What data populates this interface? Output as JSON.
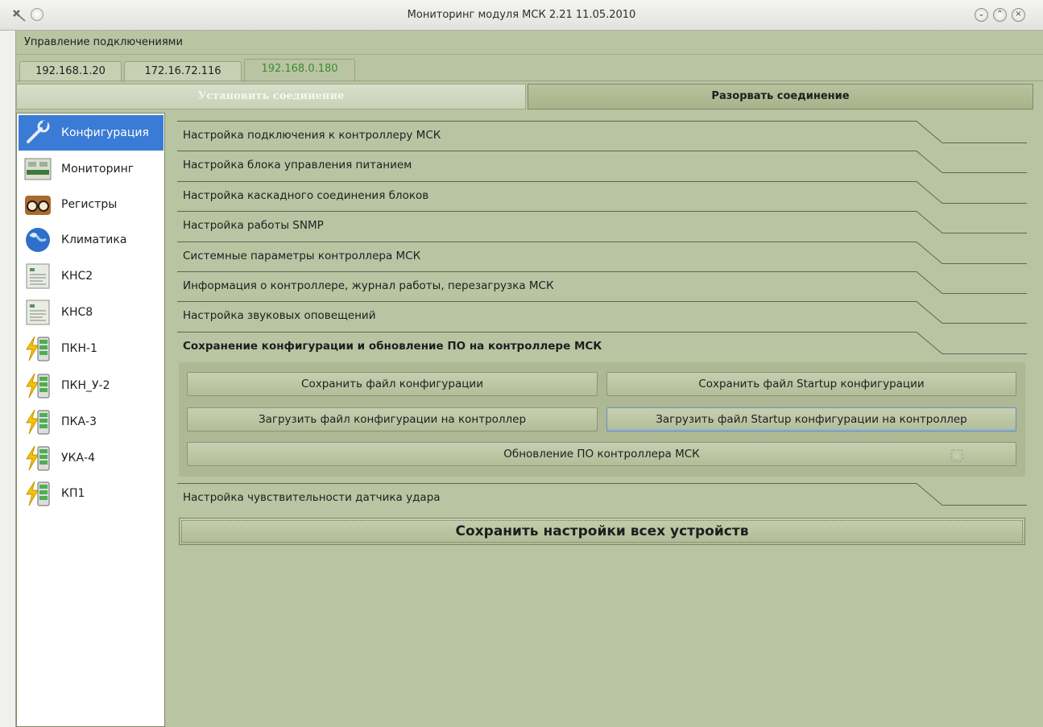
{
  "window": {
    "title": "Мониторинг модуля МСК 2.21 11.05.2010"
  },
  "menu": {
    "connections": "Управление подключениями"
  },
  "tabs": [
    {
      "label": "192.168.1.20"
    },
    {
      "label": "172.16.72.116"
    },
    {
      "label": "192.168.0.180"
    }
  ],
  "connection": {
    "connect_label": "Установить соединение",
    "disconnect_label": "Разорвать соединение"
  },
  "nav": {
    "items": [
      {
        "label": "Конфигурация",
        "icon": "wrench-icon"
      },
      {
        "label": "Мониторинг",
        "icon": "device-panel-icon"
      },
      {
        "label": "Регистры",
        "icon": "registers-icon"
      },
      {
        "label": "Климатика",
        "icon": "globe-icon"
      },
      {
        "label": "КНС2",
        "icon": "document-icon"
      },
      {
        "label": "КНС8",
        "icon": "document-icon"
      },
      {
        "label": "ПКН-1",
        "icon": "battery-bolt-icon"
      },
      {
        "label": "ПКН_У-2",
        "icon": "battery-bolt-icon"
      },
      {
        "label": "ПКА-3",
        "icon": "battery-bolt-icon"
      },
      {
        "label": "УКА-4",
        "icon": "battery-bolt-icon"
      },
      {
        "label": "КП1",
        "icon": "battery-bolt-icon"
      }
    ]
  },
  "sections": [
    {
      "label": "Настройка подключения к контроллеру МСК"
    },
    {
      "label": "Настройка блока управления питанием"
    },
    {
      "label": "Настройка каскадного соединения блоков"
    },
    {
      "label": "Настройка работы SNMP"
    },
    {
      "label": "Системные параметры контроллера МСК"
    },
    {
      "label": "Информация о контроллере, журнал работы, перезагрузка МСК"
    },
    {
      "label": "Настройка звуковых оповещений"
    },
    {
      "label": "Сохранение конфигурации и обновление ПО на контроллере МСК"
    },
    {
      "label": "Настройка чувствительности датчика удара"
    }
  ],
  "config_panel": {
    "save_config": "Сохранить файл конфигурации",
    "save_startup": "Сохранить файл Startup конфигурации",
    "load_config": "Загрузить файл конфигурации на контроллер",
    "load_startup": "Загрузить файл Startup конфигурации на контроллер",
    "update_firmware": "Обновление ПО контроллера МСК"
  },
  "save_all_label": "Сохранить настройки всех устройств",
  "colors": {
    "background": "#b9c4a3",
    "active_tab_text": "#3b8b2e",
    "nav_selection": "#3a7bd5"
  }
}
